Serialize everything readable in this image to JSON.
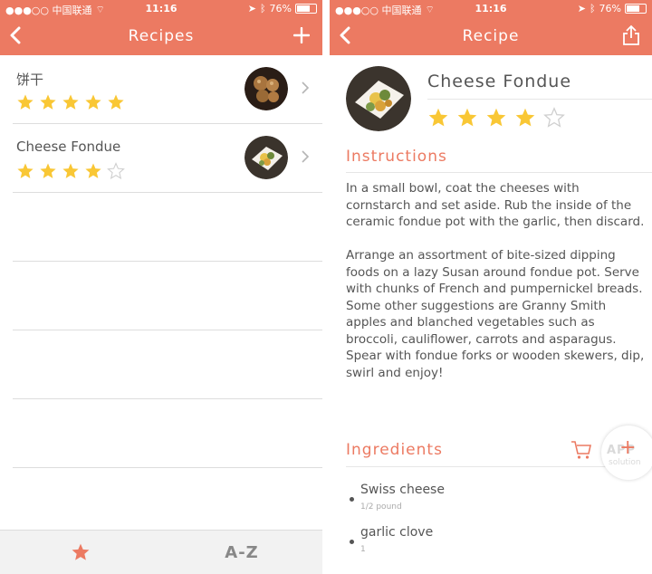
{
  "colors": {
    "accent": "#ec7a62",
    "star": "#f9c735",
    "star_empty": "#cfcfcf"
  },
  "status_bar": {
    "carrier": "●●●○○ 中国联通",
    "time": "11:16",
    "battery": "76%",
    "battery_level": 0.76
  },
  "list_screen": {
    "title": "Recipes",
    "back_icon": "chevron-left-icon",
    "add_icon": "plus-icon",
    "recipes": [
      {
        "name": "饼干",
        "rating": 5,
        "max_rating": 5
      },
      {
        "name": "Cheese Fondue",
        "rating": 4,
        "max_rating": 5
      }
    ],
    "tabs": [
      {
        "icon": "star-icon",
        "label": ""
      },
      {
        "icon": "",
        "label": "A-Z"
      }
    ]
  },
  "detail_screen": {
    "title": "Recipe",
    "share_icon": "share-icon",
    "recipe_name": "Cheese Fondue",
    "rating": 4,
    "max_rating": 5,
    "instructions_heading": "Instructions",
    "instructions": [
      "In a small bowl, coat the cheeses with cornstarch and set aside. Rub the inside of the ceramic fondue pot with the garlic, then discard.",
      "Arrange an assortment of bite-sized dipping foods on a lazy Susan around fondue pot. Serve with chunks of French and pumpernickel breads. Some other suggestions are Granny Smith apples and blanched vegetables such as broccoli, cauliflower, carrots and asparagus. Spear with fondue forks or wooden skewers, dip, swirl and enjoy!"
    ],
    "ingredients_heading": "Ingredients",
    "cart_icon": "cart-icon",
    "ingredients": [
      {
        "name": "Swiss cheese",
        "quantity": "1/2 pound"
      },
      {
        "name": "garlic clove",
        "quantity": "1"
      }
    ],
    "fab": {
      "label": "+",
      "watermark": "APP",
      "watermark_sub": "solution"
    }
  }
}
